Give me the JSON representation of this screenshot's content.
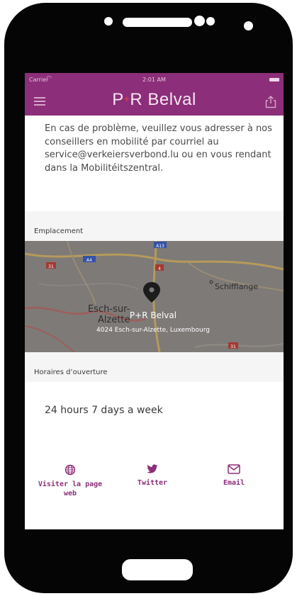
{
  "status_bar": {
    "carrier": "Carrier",
    "time": "2:01 AM"
  },
  "header": {
    "title_left": "P",
    "title_plus": "+",
    "title_right": "R Belval"
  },
  "notice_text": "En cas de problème, veuillez vous adresser à nos conseillers en mobilité par courriel au service@verkeiersverbond.lu ou en vous rendant dans la Mobilitéitszentral.",
  "location": {
    "section_label": "Emplacement",
    "map": {
      "marker_name": "P+R Belval",
      "address": "4024 Esch-sur-Alzette, Luxembourg",
      "city_label_1": "Esch-sur-",
      "city_label_2": "Alzette",
      "town_label": "Schifflange",
      "road_labels": [
        "A13",
        "A4",
        "31",
        "4",
        "31"
      ]
    }
  },
  "hours": {
    "section_label": "Horaires d’ouverture",
    "text": "24 hours 7 days a week"
  },
  "footer": {
    "website_label_1": "Visiter la page",
    "website_label_2": "web",
    "twitter_label": "Twitter",
    "email_label": "Email"
  },
  "colors": {
    "brand": "#8c2e79",
    "accent": "#e0433f"
  }
}
